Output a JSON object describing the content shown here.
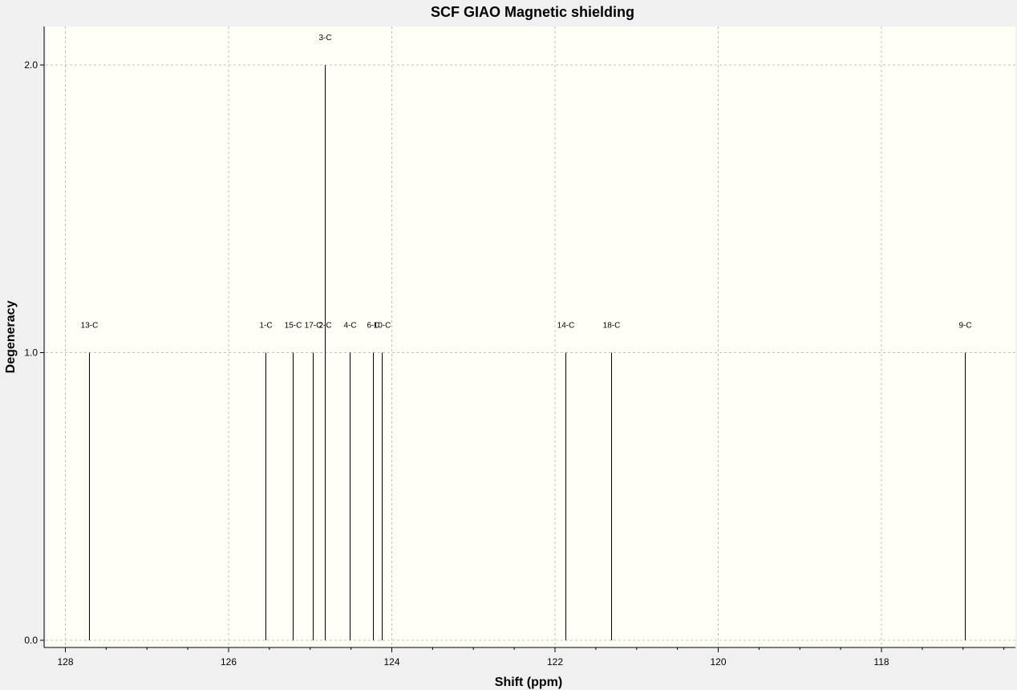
{
  "chart_data": {
    "type": "bar",
    "title": "SCF GIAO Magnetic shielding",
    "xlabel": "Shift (ppm)",
    "ylabel": "Degeneracy",
    "x_reversed": true,
    "xlim": [
      128.25,
      116.45
    ],
    "ylim": [
      0.0,
      2.15
    ],
    "x_ticks": [
      128,
      126,
      124,
      122,
      120,
      118
    ],
    "x_tick_labels": [
      "128",
      "126",
      "124",
      "122",
      "120",
      "118"
    ],
    "y_ticks": [
      0.0,
      1.0,
      2.0
    ],
    "y_tick_labels": [
      "0.0",
      "1.0",
      "2.0"
    ],
    "grid": true,
    "colors": {
      "plot_background": "#fffff7",
      "page_background": "#f0f0f0",
      "peak_line": "#000000",
      "grid": "#c0c0c0"
    },
    "peaks": [
      {
        "label": "13-C",
        "x": 127.71,
        "y": 1
      },
      {
        "label": "1-C",
        "x": 125.55,
        "y": 1
      },
      {
        "label": "15-C",
        "x": 125.21,
        "y": 1
      },
      {
        "label": "17-C",
        "x": 124.97,
        "y": 1
      },
      {
        "label": "3-C",
        "x": 124.82,
        "y": 2
      },
      {
        "label": "2-C",
        "x": 124.82,
        "y": 1
      },
      {
        "label": "4-C",
        "x": 124.52,
        "y": 1
      },
      {
        "label": "6-C",
        "x": 124.23,
        "y": 1
      },
      {
        "label": "10-C",
        "x": 124.12,
        "y": 1
      },
      {
        "label": "14-C",
        "x": 121.87,
        "y": 1
      },
      {
        "label": "18-C",
        "x": 121.31,
        "y": 1
      },
      {
        "label": "9-C",
        "x": 116.98,
        "y": 1
      }
    ]
  }
}
